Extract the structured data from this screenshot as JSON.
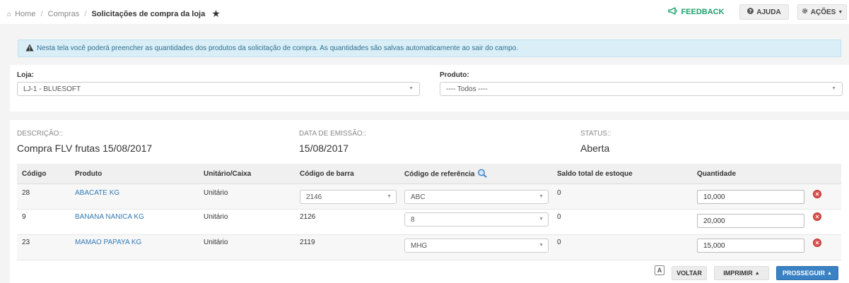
{
  "breadcrumb": {
    "home": "Home",
    "section": "Compras",
    "current": "Solicitações de compra da loja"
  },
  "toolbar": {
    "feedback": "FEEDBACK",
    "ajuda": "AJUDA",
    "acoes": "AÇÕES"
  },
  "alert": {
    "text": "Nesta tela você poderá preencher as quantidades dos produtos da solicitação de compra. As quantidades são salvas automaticamente ao sair do campo."
  },
  "filters": {
    "loja_label": "Loja:",
    "loja_value": "LJ-1 - BLUESOFT",
    "produto_label": "Produto:",
    "produto_value": "---- Todos ----"
  },
  "details": {
    "descricao_label": "DESCRIÇÃO::",
    "descricao_value": "Compra FLV frutas 15/08/2017",
    "emissao_label": "DATA DE EMISSÃO::",
    "emissao_value": "15/08/2017",
    "status_label": "STATUS::",
    "status_value": "Aberta"
  },
  "table": {
    "headers": {
      "codigo": "Código",
      "produto": "Produto",
      "unitario": "Unitário/Caixa",
      "barra": "Código de barra",
      "referencia": "Código de referência",
      "saldo": "Saldo total de estoque",
      "quantidade": "Quantidade"
    },
    "rows": [
      {
        "codigo": "28",
        "produto": "ABACATE KG",
        "unitario": "Unitário",
        "barra": "2146",
        "referencia": "ABC",
        "saldo": "0",
        "quantidade": "10,000"
      },
      {
        "codigo": "9",
        "produto": "BANANA NANICA KG",
        "unitario": "Unitário",
        "barra": "2126",
        "referencia": "8",
        "saldo": "0",
        "quantidade": "20,000"
      },
      {
        "codigo": "23",
        "produto": "MAMAO PAPAYA KG",
        "unitario": "Unitário",
        "barra": "2119",
        "referencia": "MHG",
        "saldo": "0",
        "quantidade": "15,000"
      }
    ]
  },
  "bottom": {
    "font_toggle": "A",
    "voltar": "VOLTAR",
    "imprimir": "IMPRIMIR",
    "prosseguir": "PROSSEGUIR"
  },
  "icons": {
    "home": "home-icon",
    "star": "star-icon",
    "feedback": "megaphone-icon",
    "ajuda": "question-circle-icon",
    "acoes": "gear-icon",
    "alert": "warning-icon",
    "search": "magnifier-icon",
    "delete": "remove-circle-icon"
  },
  "colors": {
    "accent_blue": "#3a82c4",
    "feedback_green": "#1aa36b",
    "alert_bg": "#d9eef7",
    "link_blue": "#337ab7",
    "delete_red": "#d9534f"
  }
}
